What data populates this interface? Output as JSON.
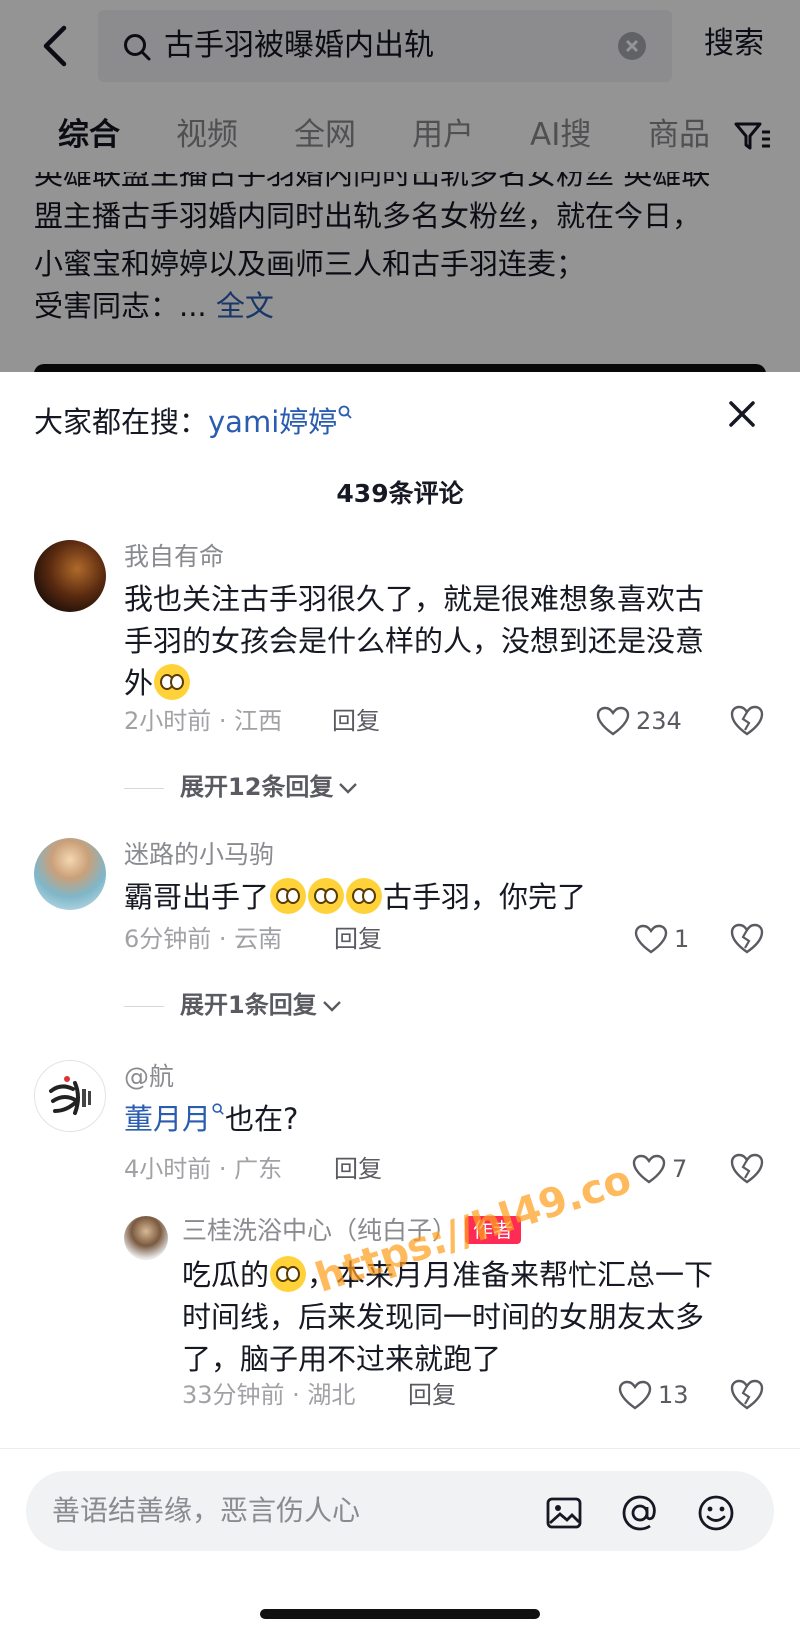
{
  "search": {
    "query": "古手羽被曝婚内出轨",
    "search_label": "搜索"
  },
  "tabs": [
    {
      "label": "综合",
      "active": true
    },
    {
      "label": "视频"
    },
    {
      "label": "全网"
    },
    {
      "label": "用户"
    },
    {
      "label": "AI搜"
    },
    {
      "label": "商品"
    }
  ],
  "background_post": {
    "lines": [
      "英雄联盟主播古手羽婚内同时出轨多名女粉丝 英雄联",
      "盟主播古手羽婚内同时出轨多名女粉丝，就在今日，",
      "小蜜宝和婷婷以及画师三人和古手羽连麦；",
      "受害同志：..."
    ],
    "more_label": "全文"
  },
  "comments_sheet": {
    "trending_prefix": "大家都在搜：",
    "trending_keyword": "yami婷婷",
    "count_label": "439条评论",
    "reply_label": "回复",
    "comments": [
      {
        "username": "我自有命",
        "text_lines": [
          "我也关注古手羽很久了，就是很难想象喜欢古",
          "手羽的女孩会是什么样的人，没想到还是没意",
          "外"
        ],
        "emoji": "flushed-face-emoji",
        "meta": "2小时前 · 江西",
        "likes": "234",
        "expand": "展开12条回复"
      },
      {
        "username": "迷路的小马驹",
        "text_before": "霸哥出手了",
        "emojis": [
          "pleading-face-emoji",
          "pleading-face-emoji",
          "pleading-face-emoji"
        ],
        "text_after": "古手羽，你完了",
        "meta": "6分钟前 · 云南",
        "likes": "1",
        "expand": "展开1条回复"
      },
      {
        "username": "@航",
        "mention": "董月月",
        "text_after": "也在?",
        "meta": "4小时前 · 广东",
        "likes": "7",
        "reply": {
          "username": "三桂洗浴中心（纯白子）",
          "badge": "作者",
          "text_lines": [
            "吃瓜的",
            "，本来月月准备来帮忙汇总一下",
            "时间线，后来发现同一时间的女朋友太多",
            "了，脑子用不过来就跑了"
          ],
          "emoji": "crying-laughing-emoji",
          "meta": "33分钟前 · 湖北",
          "likes": "13"
        }
      }
    ]
  },
  "watermark": "https://hl49.co",
  "composer": {
    "placeholder": "善语结善缘，恶言伤人心"
  }
}
